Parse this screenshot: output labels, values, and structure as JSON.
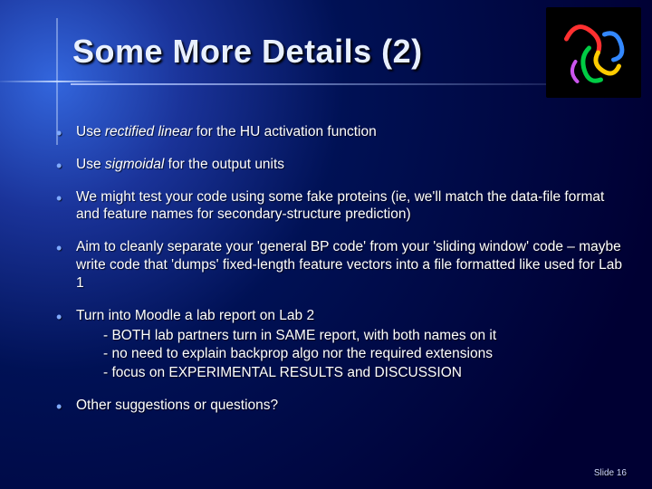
{
  "title": "Some More Details (2)",
  "bullets": [
    {
      "pre": "Use ",
      "term": "rectified linear",
      "post": " for the HU activation function"
    },
    {
      "pre": "Use ",
      "term": "sigmoidal",
      "post": " for the output units"
    },
    {
      "text": "We might test your code using some fake proteins (ie, we'll match the data-file format and feature names for secondary-structure prediction)"
    },
    {
      "text": "Aim to cleanly separate your 'general BP code' from your 'sliding window' code – maybe write code that 'dumps' fixed-length feature vectors into a file formatted like used for Lab 1"
    },
    {
      "text": "Turn into Moodle a lab report on Lab 2",
      "sub": [
        "- BOTH lab partners turn in SAME report, with both names on it",
        "- no need to explain backprop algo nor the required extensions",
        "- focus on EXPERIMENTAL RESULTS and DISCUSSION"
      ]
    },
    {
      "text": "Other suggestions or questions?"
    }
  ],
  "footer": "Slide 16"
}
